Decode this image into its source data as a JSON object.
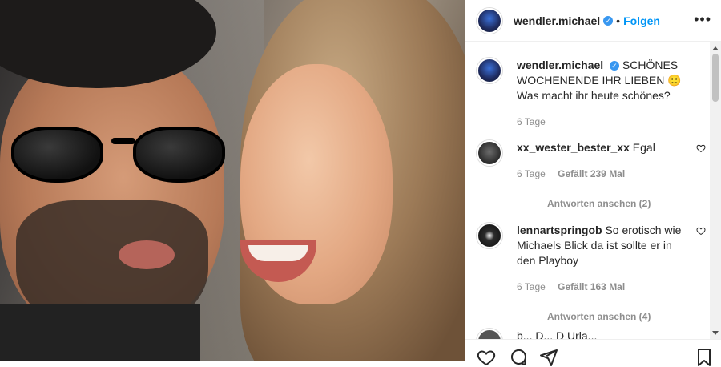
{
  "header": {
    "username": "wendler.michael",
    "verified_glyph": "✓",
    "separator": "•",
    "follow_label": "Folgen",
    "more_label": "•••"
  },
  "caption": {
    "username": "wendler.michael",
    "verified_glyph": "✓",
    "text": "SCHÖNES WOCHENENDE IHR LIEBEN 🙂 Was macht ihr heute schönes?",
    "age": "6 Tage"
  },
  "comments": [
    {
      "username": "xx_wester_bester_xx",
      "text": "Egal",
      "age": "6 Tage",
      "likes": "Gefällt 239 Mal",
      "replies": "Antworten ansehen (2)"
    },
    {
      "username": "lennartspringob",
      "text": "So erotisch wie Michaels Blick da ist sollte er in den Playboy",
      "age": "6 Tage",
      "likes": "Gefällt 163 Mal",
      "replies": "Antworten ansehen (4)"
    }
  ],
  "partial_comment": {
    "text": "b... D... D Urla..."
  },
  "icons": {
    "like": "heart-icon",
    "comment": "comment-icon",
    "share": "paper-plane-icon",
    "save": "bookmark-icon",
    "more": "more-icon"
  },
  "colors": {
    "accent": "#0095f6",
    "verified": "#3897f0",
    "meta_text": "#8e8e8e"
  }
}
